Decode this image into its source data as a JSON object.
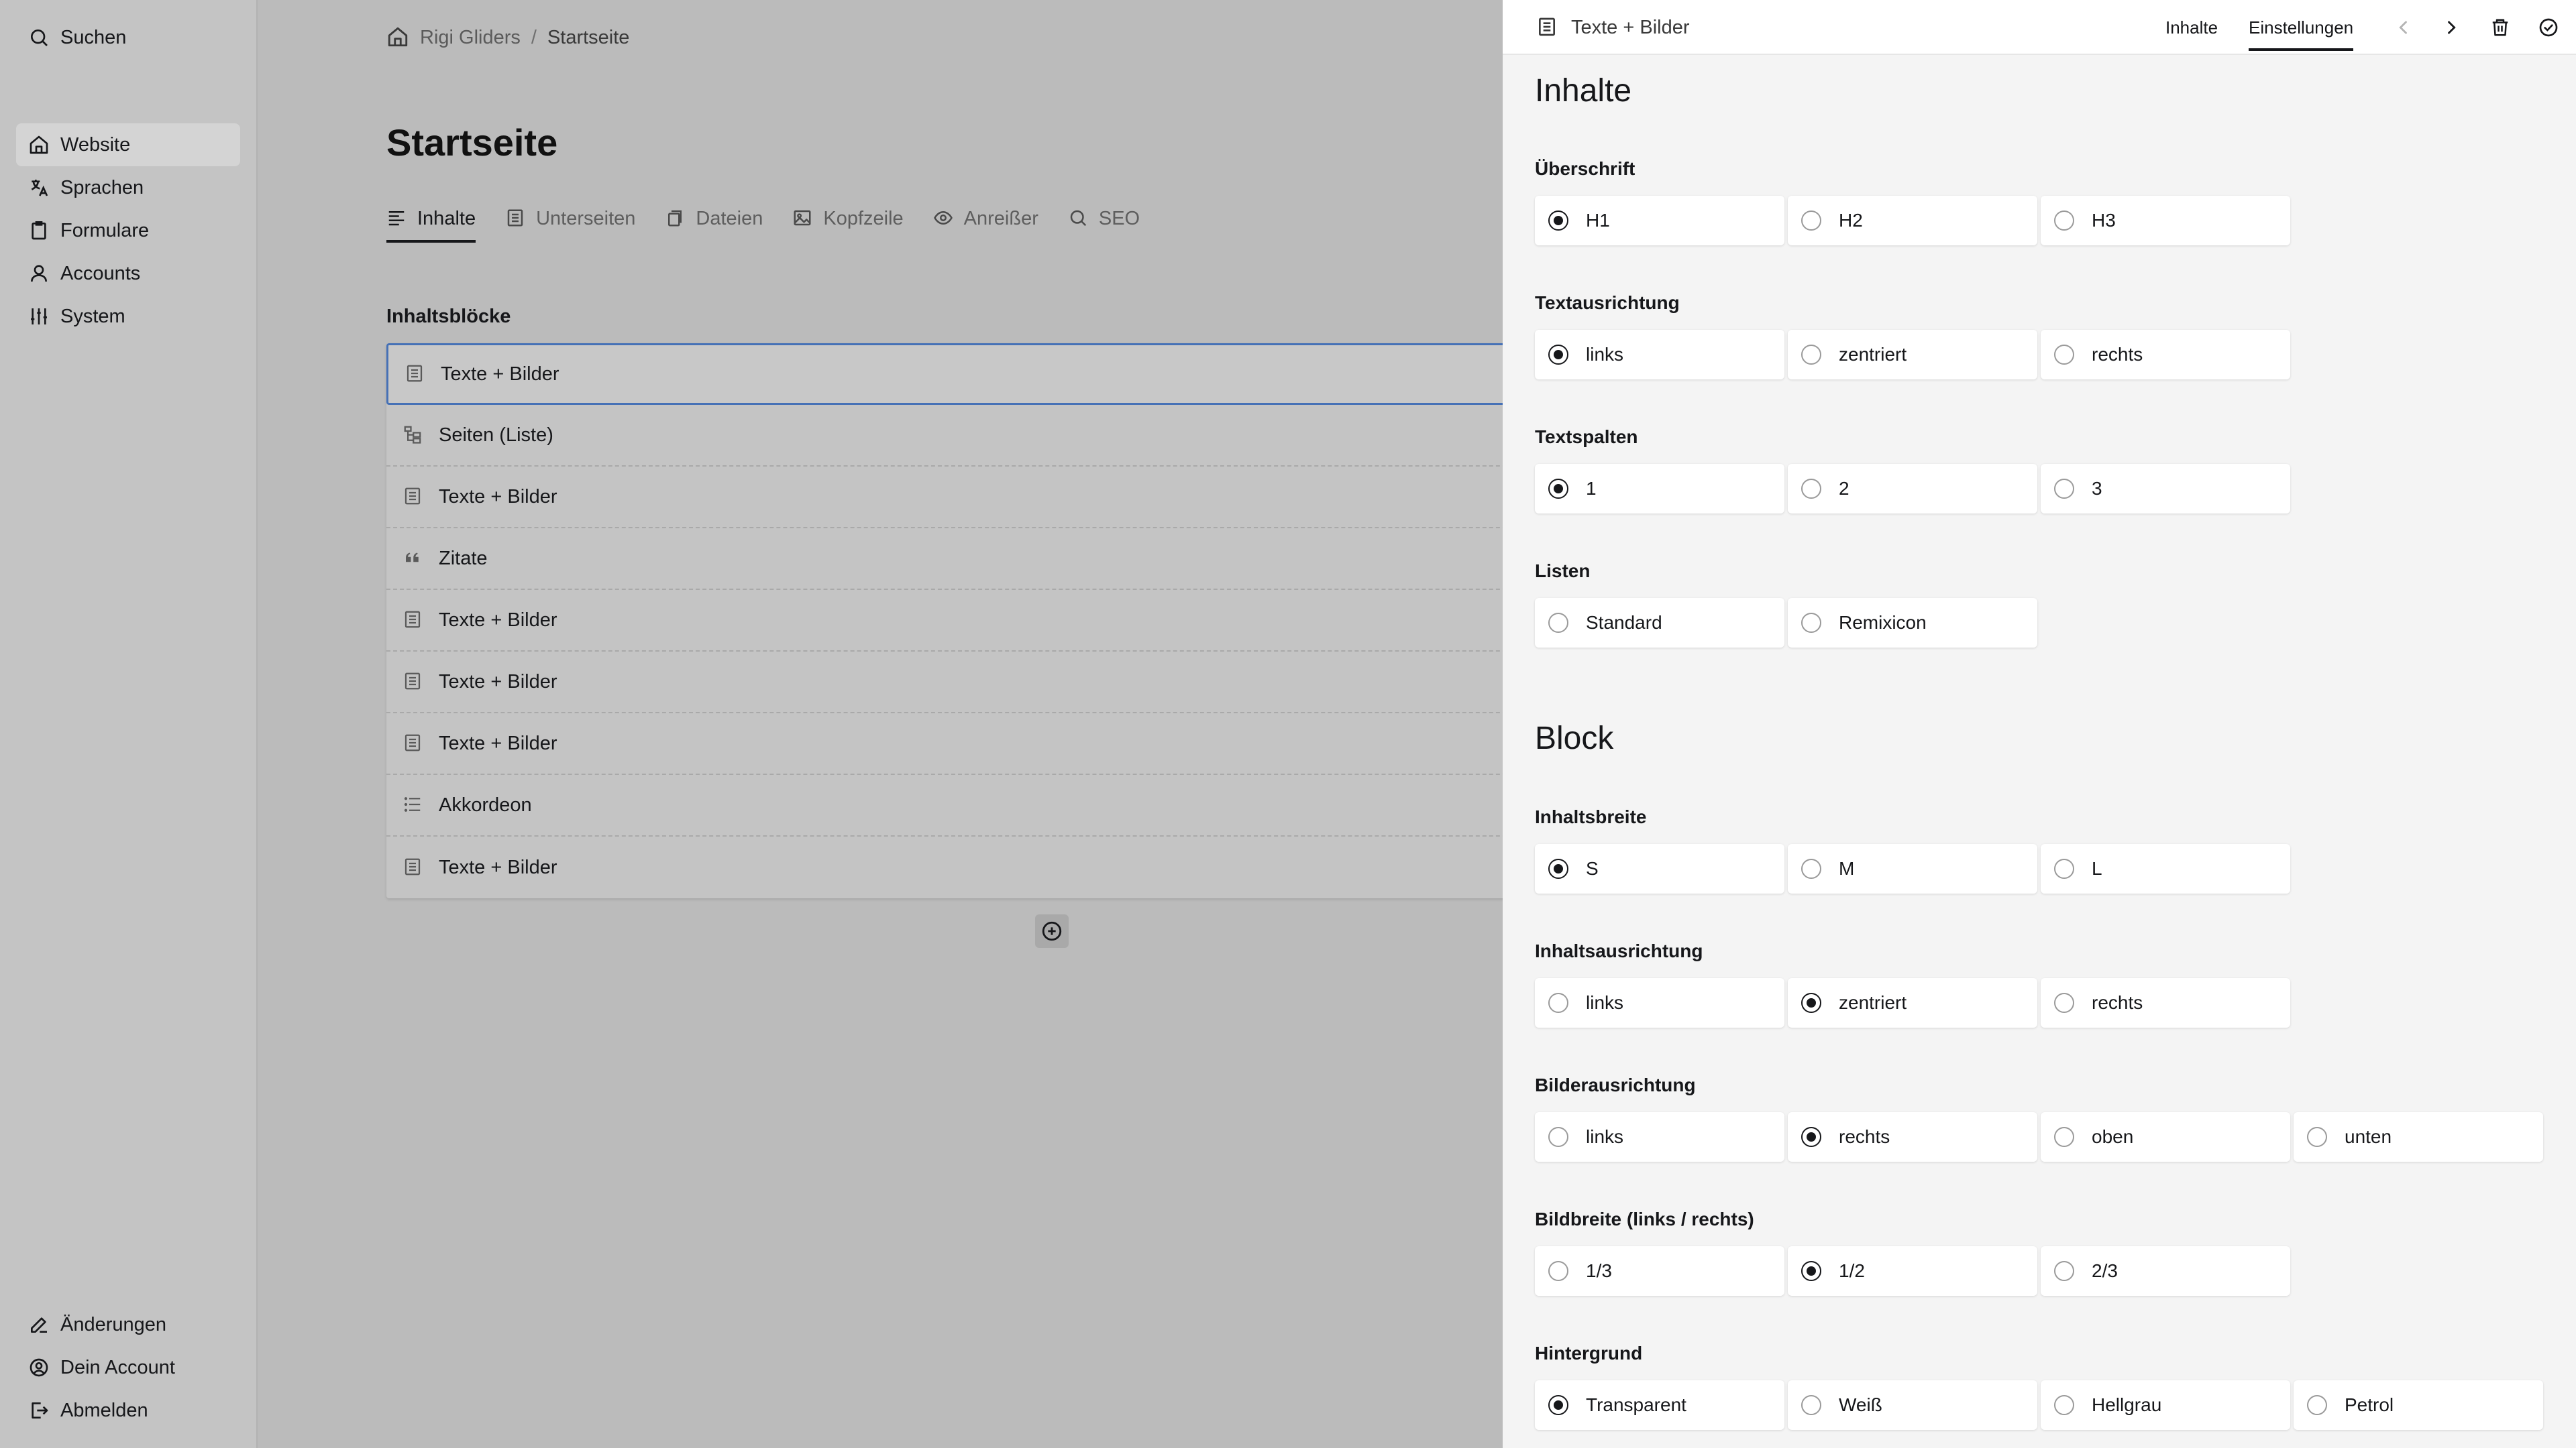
{
  "sidebar": {
    "search_label": "Suchen",
    "nav": [
      {
        "label": "Website",
        "icon": "home-icon",
        "active": true
      },
      {
        "label": "Sprachen",
        "icon": "translate-icon"
      },
      {
        "label": "Formulare",
        "icon": "clipboard-icon"
      },
      {
        "label": "Accounts",
        "icon": "user-icon"
      },
      {
        "label": "System",
        "icon": "sliders-icon"
      }
    ],
    "bottom": [
      {
        "label": "Änderungen",
        "icon": "edit-icon"
      },
      {
        "label": "Dein Account",
        "icon": "account-icon"
      },
      {
        "label": "Abmelden",
        "icon": "logout-icon"
      }
    ]
  },
  "main": {
    "breadcrumb": {
      "root": "Rigi Gliders",
      "separator": "/",
      "current": "Startseite"
    },
    "title": "Startseite",
    "tabs": [
      {
        "label": "Inhalte",
        "icon": "text-align-icon",
        "active": true
      },
      {
        "label": "Unterseiten",
        "icon": "page-icon"
      },
      {
        "label": "Dateien",
        "icon": "files-icon"
      },
      {
        "label": "Kopfzeile",
        "icon": "image-icon"
      },
      {
        "label": "Anreißer",
        "icon": "eye-icon"
      },
      {
        "label": "SEO",
        "icon": "search-icon"
      }
    ],
    "blocks_label": "Inhaltsblöcke",
    "blocks": [
      {
        "label": "Texte + Bilder",
        "icon": "text-image-icon"
      },
      {
        "label": "Seiten (Liste)",
        "icon": "tree-icon"
      },
      {
        "label": "Texte + Bilder",
        "icon": "text-image-icon"
      },
      {
        "label": "Zitate",
        "icon": "quote-icon"
      },
      {
        "label": "Texte + Bilder",
        "icon": "text-image-icon"
      },
      {
        "label": "Texte + Bilder",
        "icon": "text-image-icon"
      },
      {
        "label": "Texte + Bilder",
        "icon": "text-image-icon"
      },
      {
        "label": "Akkordeon",
        "icon": "list-icon"
      },
      {
        "label": "Texte + Bilder",
        "icon": "text-image-icon"
      }
    ]
  },
  "drawer": {
    "title": "Texte + Bilder",
    "tabs": [
      {
        "label": "Inhalte",
        "active": false
      },
      {
        "label": "Einstellungen",
        "active": true
      }
    ],
    "sections": [
      {
        "heading": "Inhalte",
        "fields": [
          {
            "label": "Überschrift",
            "options": [
              "H1",
              "H2",
              "H3"
            ],
            "selected": 0
          },
          {
            "label": "Textausrichtung",
            "options": [
              "links",
              "zentriert",
              "rechts"
            ],
            "selected": 0
          },
          {
            "label": "Textspalten",
            "options": [
              "1",
              "2",
              "3"
            ],
            "selected": 0
          },
          {
            "label": "Listen",
            "options": [
              "Standard",
              "Remixicon"
            ],
            "selected": -1
          }
        ]
      },
      {
        "heading": "Block",
        "fields": [
          {
            "label": "Inhaltsbreite",
            "options": [
              "S",
              "M",
              "L"
            ],
            "selected": 0
          },
          {
            "label": "Inhaltsausrichtung",
            "options": [
              "links",
              "zentriert",
              "rechts"
            ],
            "selected": 1
          },
          {
            "label": "Bilderausrichtung",
            "options": [
              "links",
              "rechts",
              "oben",
              "unten"
            ],
            "selected": 1
          },
          {
            "label": "Bildbreite (links / rechts)",
            "options": [
              "1/3",
              "1/2",
              "2/3"
            ],
            "selected": 1
          },
          {
            "label": "Hintergrund",
            "options": [
              "Transparent",
              "Weiß",
              "Hellgrau",
              "Petrol"
            ],
            "selected": 0
          }
        ]
      }
    ]
  }
}
